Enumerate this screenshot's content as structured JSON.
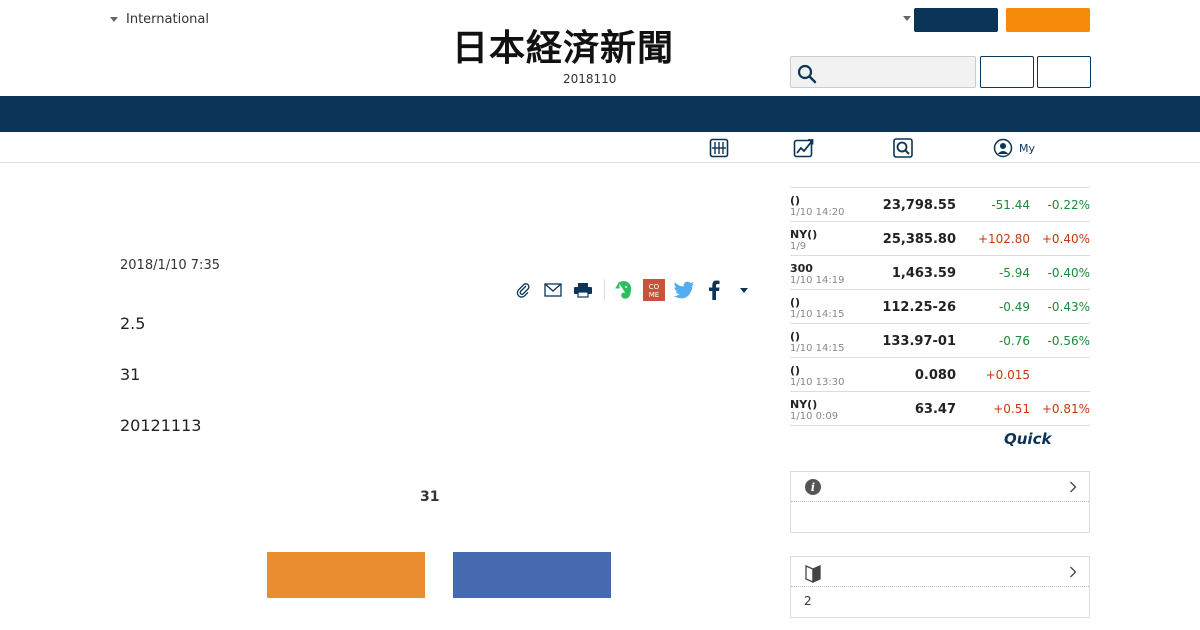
{
  "header": {
    "edition_label": "International",
    "logo_text": "日本経済新聞",
    "date_line": "2018110",
    "search_placeholder": ""
  },
  "subnav": {
    "items": [
      {
        "icon": "newspaper-icon",
        "label": ""
      },
      {
        "icon": "chart-icon",
        "label": ""
      },
      {
        "icon": "search-icon",
        "label": ""
      },
      {
        "icon": "user-icon",
        "label": "My"
      }
    ]
  },
  "article": {
    "date": "2018/1/10 7:35",
    "paragraphs": [
      "2.5",
      "31",
      "20121113"
    ],
    "chart_title": "31",
    "bar_colors": [
      "#ea8c30",
      "#456ab0"
    ]
  },
  "market": {
    "rows": [
      {
        "name": "()",
        "time": "1/10 14:20",
        "value": "23,798.55",
        "change": "-51.44",
        "pct": "-0.22%",
        "dir": "neg"
      },
      {
        "name": "NY()",
        "time": "1/9",
        "value": "25,385.80",
        "change": "+102.80",
        "pct": "+0.40%",
        "dir": "pos"
      },
      {
        "name": "300",
        "time": "1/10 14:19",
        "value": "1,463.59",
        "change": "-5.94",
        "pct": "-0.40%",
        "dir": "neg"
      },
      {
        "name": "()",
        "time": "1/10 14:15",
        "value": "112.25-26",
        "change": "-0.49",
        "pct": "-0.43%",
        "dir": "neg"
      },
      {
        "name": "()",
        "time": "1/10 14:15",
        "value": "133.97-01",
        "change": "-0.76",
        "pct": "-0.56%",
        "dir": "neg"
      },
      {
        "name": "()",
        "time": "1/10 13:30",
        "value": "0.080",
        "change": "+0.015",
        "pct": "",
        "dir": "pos"
      },
      {
        "name": "NY()",
        "time": "1/10 0:09",
        "value": "63.47",
        "change": "+0.51",
        "pct": "+0.81%",
        "dir": "pos"
      }
    ],
    "provider": "Quick"
  },
  "side_boxes": [
    {
      "icon": "info-icon",
      "body": ""
    },
    {
      "icon": "beginner-mark-icon",
      "body": "2"
    }
  ],
  "colors": {
    "navy": "#0b3558",
    "orange": "#f58b09",
    "negative": "#1a8a3a",
    "positive": "#c6390e"
  }
}
